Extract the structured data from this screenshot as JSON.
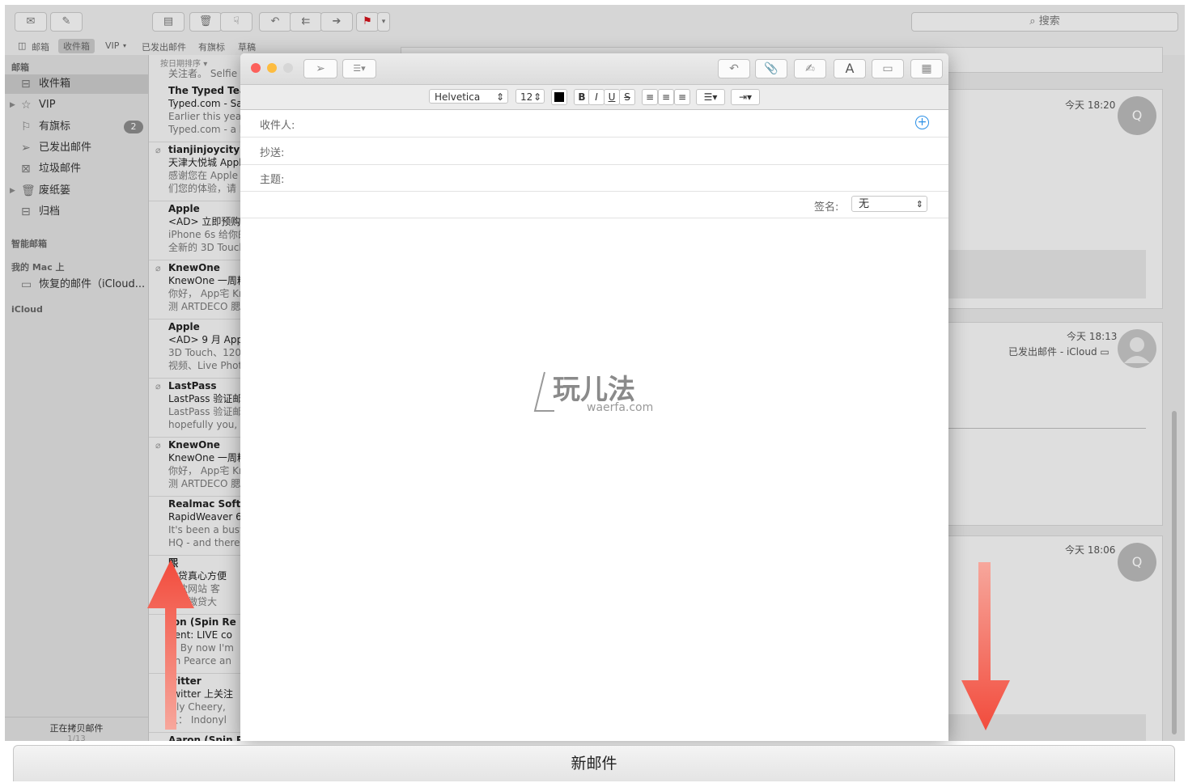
{
  "toolbar": {
    "search_placeholder": "搜索"
  },
  "favorites_bar": [
    "邮箱",
    "收件箱",
    "VIP",
    "已发出邮件",
    "有旗标",
    "草稿"
  ],
  "sidebar": {
    "section_mailboxes": "邮箱",
    "items": [
      {
        "label": "收件箱",
        "icon": "inbox-icon"
      },
      {
        "label": "VIP",
        "icon": "star-icon"
      },
      {
        "label": "有旗标",
        "icon": "flag-icon",
        "badge": "2"
      },
      {
        "label": "已发出邮件",
        "icon": "paper-plane-icon"
      },
      {
        "label": "垃圾邮件",
        "icon": "junk-icon"
      },
      {
        "label": "废纸篓",
        "icon": "trash-icon"
      },
      {
        "label": "归档",
        "icon": "archive-icon"
      }
    ],
    "section_smart": "智能邮箱",
    "section_onmac": "我的 Mac 上",
    "recovered": "恢复的邮件（iCloud...",
    "section_icloud": "iCloud",
    "status": "正在拷贝邮件",
    "status_progress": "1/13"
  },
  "message_list": {
    "sort_label": "按日期排序",
    "top_fragment": "关注者。 Selfie",
    "messages": [
      {
        "sender": "The Typed Tea",
        "subject": "Typed.com - Sa",
        "preview1": "Earlier this year",
        "preview2": "Typed.com - a b"
      },
      {
        "sender": "tianjinjoycity@",
        "subject": "天津大悦城 Appl",
        "preview1": "感谢您在 Apple",
        "preview2": "们您的体验，请"
      },
      {
        "sender": "Apple",
        "subject": "<AD> 立即预购",
        "preview1": "iPhone 6s 给你的",
        "preview2": "全新的 3D Touch"
      },
      {
        "sender": "KnewOne",
        "subject": "KnewOne 一周精",
        "preview1": "你好， App宅 Kr",
        "preview2": "测 ARTDECO 腮"
      },
      {
        "sender": "Apple",
        "subject": "<AD> 9 月 Appl",
        "preview1": "3D Touch、120",
        "preview2": "视频、Live Phot"
      },
      {
        "sender": "LastPass",
        "subject": "LastPass 验证邮",
        "preview1": "LastPass 验证邮",
        "preview2": "hopefully you, r"
      },
      {
        "sender": "KnewOne",
        "subject": "KnewOne 一周精",
        "preview1": "你好， App宅 Kr",
        "preview2": "测 ARTDECO 腮"
      },
      {
        "sender": "Realmac Softw",
        "subject": "RapidWeaver 6.",
        "preview1": "It's been a busy",
        "preview2": "HQ - and there'"
      },
      {
        "sender": "熙",
        "subject": "数贷真心方便",
        "preview1": "贷款网站 客",
        "preview2": "蚂蚁微贷大"
      },
      {
        "sender": "ron (Spin Re",
        "subject": "gent: LIVE co",
        "preview1": "y, By now I'm",
        "preview2": "hn Pearce an"
      },
      {
        "sender": "witter",
        "subject": "Twitter 上关注",
        "preview1": "Lily Cheery,",
        "preview2": "人： Indonyl"
      },
      {
        "sender": "Aaron (Spin Re",
        "subject": "",
        "preview1": "",
        "preview2": ""
      }
    ]
  },
  "reader": {
    "cards": [
      {
        "time": "今天 18:20",
        "avatar": "Q",
        "folder": ""
      },
      {
        "time": "今天 18:13",
        "avatar": "",
        "folder": "已发出邮件 - iCloud"
      },
      {
        "time": "今天 18:06",
        "avatar": "Q",
        "folder": ""
      }
    ]
  },
  "compose": {
    "font": "Helvetica",
    "size": "12",
    "bold": "B",
    "italic": "I",
    "underline": "U",
    "strike": "S",
    "to_label": "收件人:",
    "cc_label": "抄送:",
    "subject_label": "主题:",
    "signature_label": "签名:",
    "signature_value": "无",
    "font_button": "A"
  },
  "watermark": {
    "text": "玩儿法",
    "url": "waerfa.com"
  },
  "bottom_button": "新邮件",
  "colors": {
    "close": "#fc605b",
    "minimize": "#fdbc40",
    "annotation_arrow": "#f24b3c",
    "add_recipient": "#2a8fe6",
    "flag": "#d0121b"
  }
}
